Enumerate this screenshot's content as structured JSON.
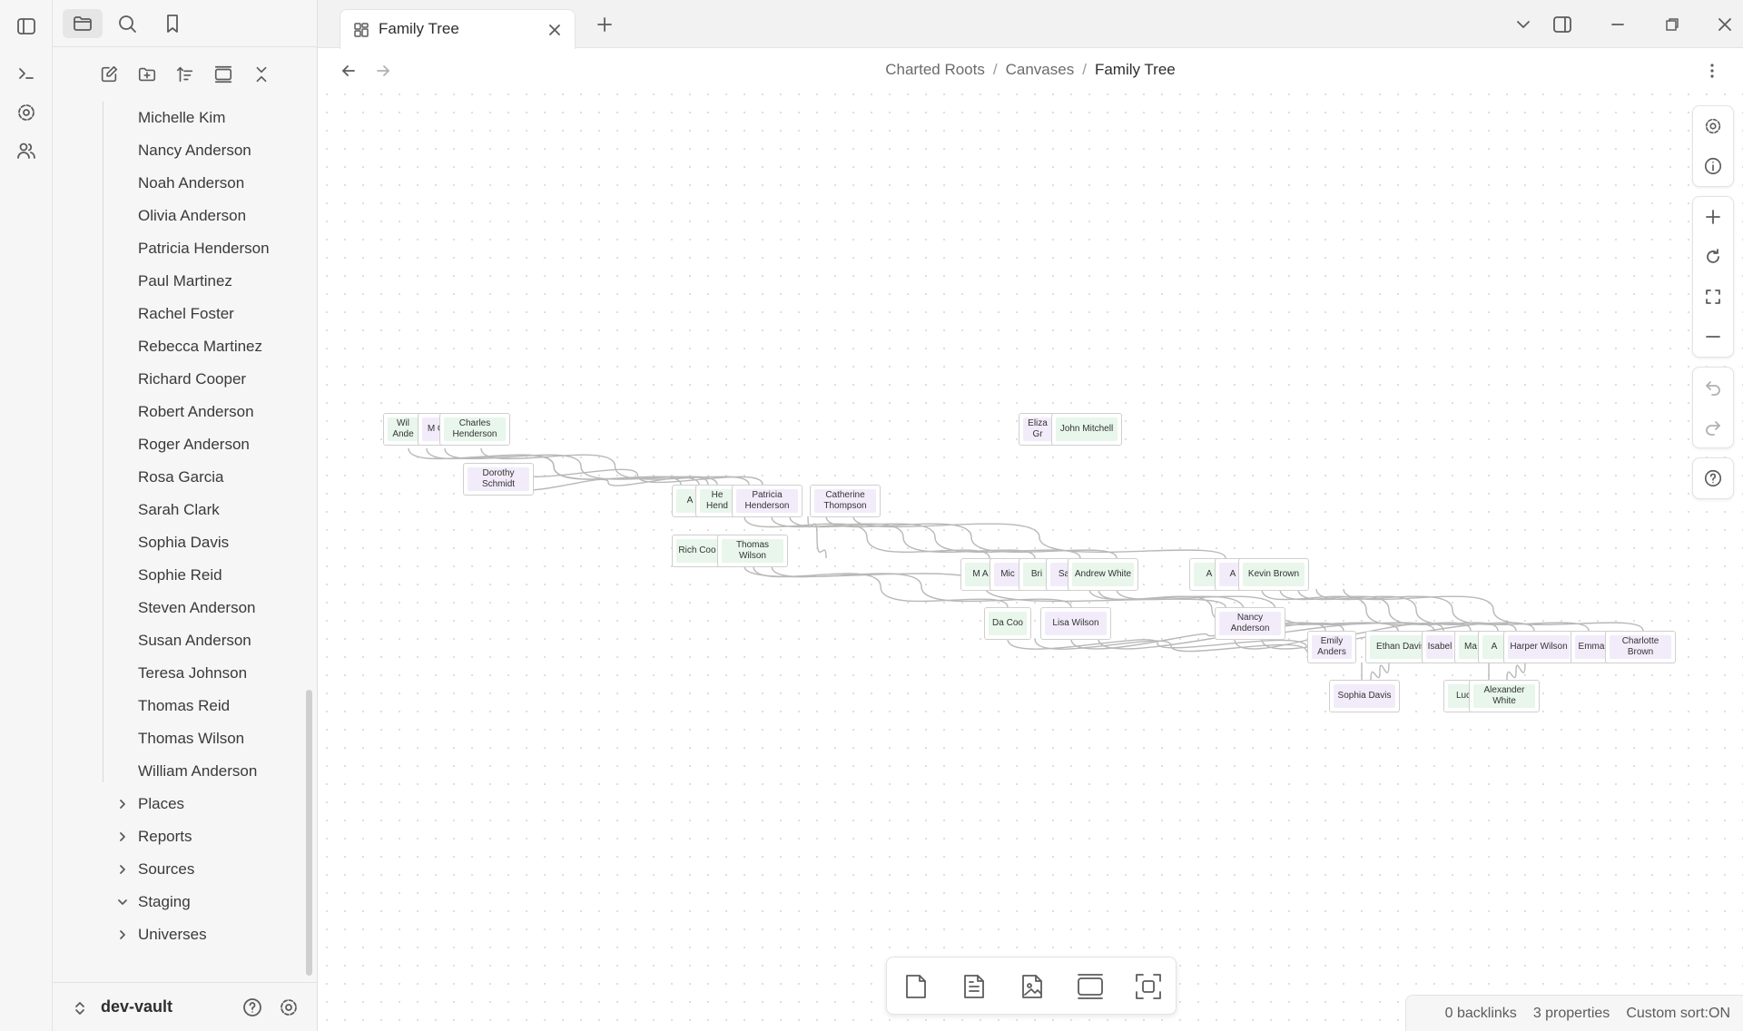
{
  "tab": {
    "title": "Family Tree"
  },
  "breadcrumb": {
    "part1": "Charted Roots",
    "sep": "/",
    "part2": "Canvases",
    "current": "Family Tree"
  },
  "sidebar": {
    "people": [
      "Michelle Kim",
      "Nancy Anderson",
      "Noah Anderson",
      "Olivia Anderson",
      "Patricia Henderson",
      "Paul Martinez",
      "Rachel Foster",
      "Rebecca Martinez",
      "Richard Cooper",
      "Robert Anderson",
      "Roger Anderson",
      "Rosa Garcia",
      "Sarah Clark",
      "Sophia Davis",
      "Sophie Reid",
      "Steven Anderson",
      "Susan Anderson",
      "Teresa Johnson",
      "Thomas Reid",
      "Thomas Wilson",
      "William Anderson"
    ],
    "folders": [
      {
        "label": "Places",
        "expanded": false
      },
      {
        "label": "Reports",
        "expanded": false
      },
      {
        "label": "Sources",
        "expanded": false
      },
      {
        "label": "Staging",
        "expanded": true
      },
      {
        "label": "Universes",
        "expanded": false
      }
    ],
    "vault_name": "dev-vault"
  },
  "graph": {
    "nodes": [
      {
        "text": "Wil Ande",
        "gender": "m"
      },
      {
        "text": "M C",
        "gender": "f"
      },
      {
        "text": "Charles Henderson",
        "gender": "m"
      },
      {
        "text": "Dorothy Schmidt",
        "gender": "f"
      },
      {
        "text": "Eliza Gr",
        "gender": "f"
      },
      {
        "text": "John Mitchell",
        "gender": "m"
      },
      {
        "text": "A",
        "gender": "m"
      },
      {
        "text": "He Hend",
        "gender": "m"
      },
      {
        "text": "Patricia Henderson",
        "gender": "f"
      },
      {
        "text": "Catherine Thompson",
        "gender": "f"
      },
      {
        "text": "Rich Coo",
        "gender": "m"
      },
      {
        "text": "Thomas Wilson",
        "gender": "m"
      },
      {
        "text": "M A",
        "gender": "m"
      },
      {
        "text": "Mic",
        "gender": "f"
      },
      {
        "text": "Bri",
        "gender": "m"
      },
      {
        "text": "Sa",
        "gender": "f"
      },
      {
        "text": "Andrew White",
        "gender": "m"
      },
      {
        "text": "A",
        "gender": "m"
      },
      {
        "text": "A",
        "gender": "f"
      },
      {
        "text": "Kevin Brown",
        "gender": "m"
      },
      {
        "text": "Da Coo",
        "gender": "m"
      },
      {
        "text": "Lisa Wilson",
        "gender": "f"
      },
      {
        "text": "Nancy Anderson",
        "gender": "f"
      },
      {
        "text": "Emily Anders",
        "gender": "f"
      },
      {
        "text": "Ethan Davis",
        "gender": "m"
      },
      {
        "text": "Isabel",
        "gender": "f"
      },
      {
        "text": "Ma",
        "gender": "m"
      },
      {
        "text": "A",
        "gender": "m"
      },
      {
        "text": "Harper Wilson",
        "gender": "f"
      },
      {
        "text": "Emma",
        "gender": "f"
      },
      {
        "text": "Charlotte Brown",
        "gender": "f"
      },
      {
        "text": "Sophia Davis",
        "gender": "f"
      },
      {
        "text": "Luc",
        "gender": "m"
      },
      {
        "text": "Alexander White",
        "gender": "m"
      }
    ]
  },
  "status": {
    "backlinks": "0 backlinks",
    "properties": "3 properties",
    "sort": "Custom sort:ON"
  },
  "colors": {
    "female_fill": "#f2ecfa",
    "male_fill": "#e8f6ec",
    "edge": "#b8b8b8"
  }
}
